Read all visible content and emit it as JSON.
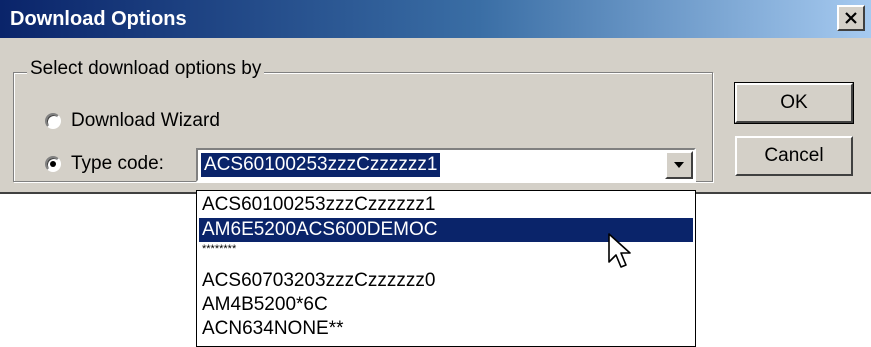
{
  "window": {
    "title": "Download Options",
    "close_label": "×"
  },
  "group": {
    "legend": "Select download options by"
  },
  "options": {
    "wizard_label": "Download Wizard",
    "type_code_label": "Type code:",
    "selected": "type_code"
  },
  "combo": {
    "value": "ACS60100253zzzCzzzzzz1"
  },
  "buttons": {
    "ok": "OK",
    "cancel": "Cancel"
  },
  "dropdown": {
    "items": [
      "ACS60100253zzzCzzzzzz1",
      "AM6E5200ACS600DEMOC",
      "********",
      "ACS60703203zzzCzzzzzz0",
      "AM4B5200*6C",
      "ACN634NONE**"
    ],
    "highlighted_index": 1
  },
  "colors": {
    "titlebar": "#0a246a",
    "selection": "#0a246a",
    "face": "#d4d0c8"
  }
}
